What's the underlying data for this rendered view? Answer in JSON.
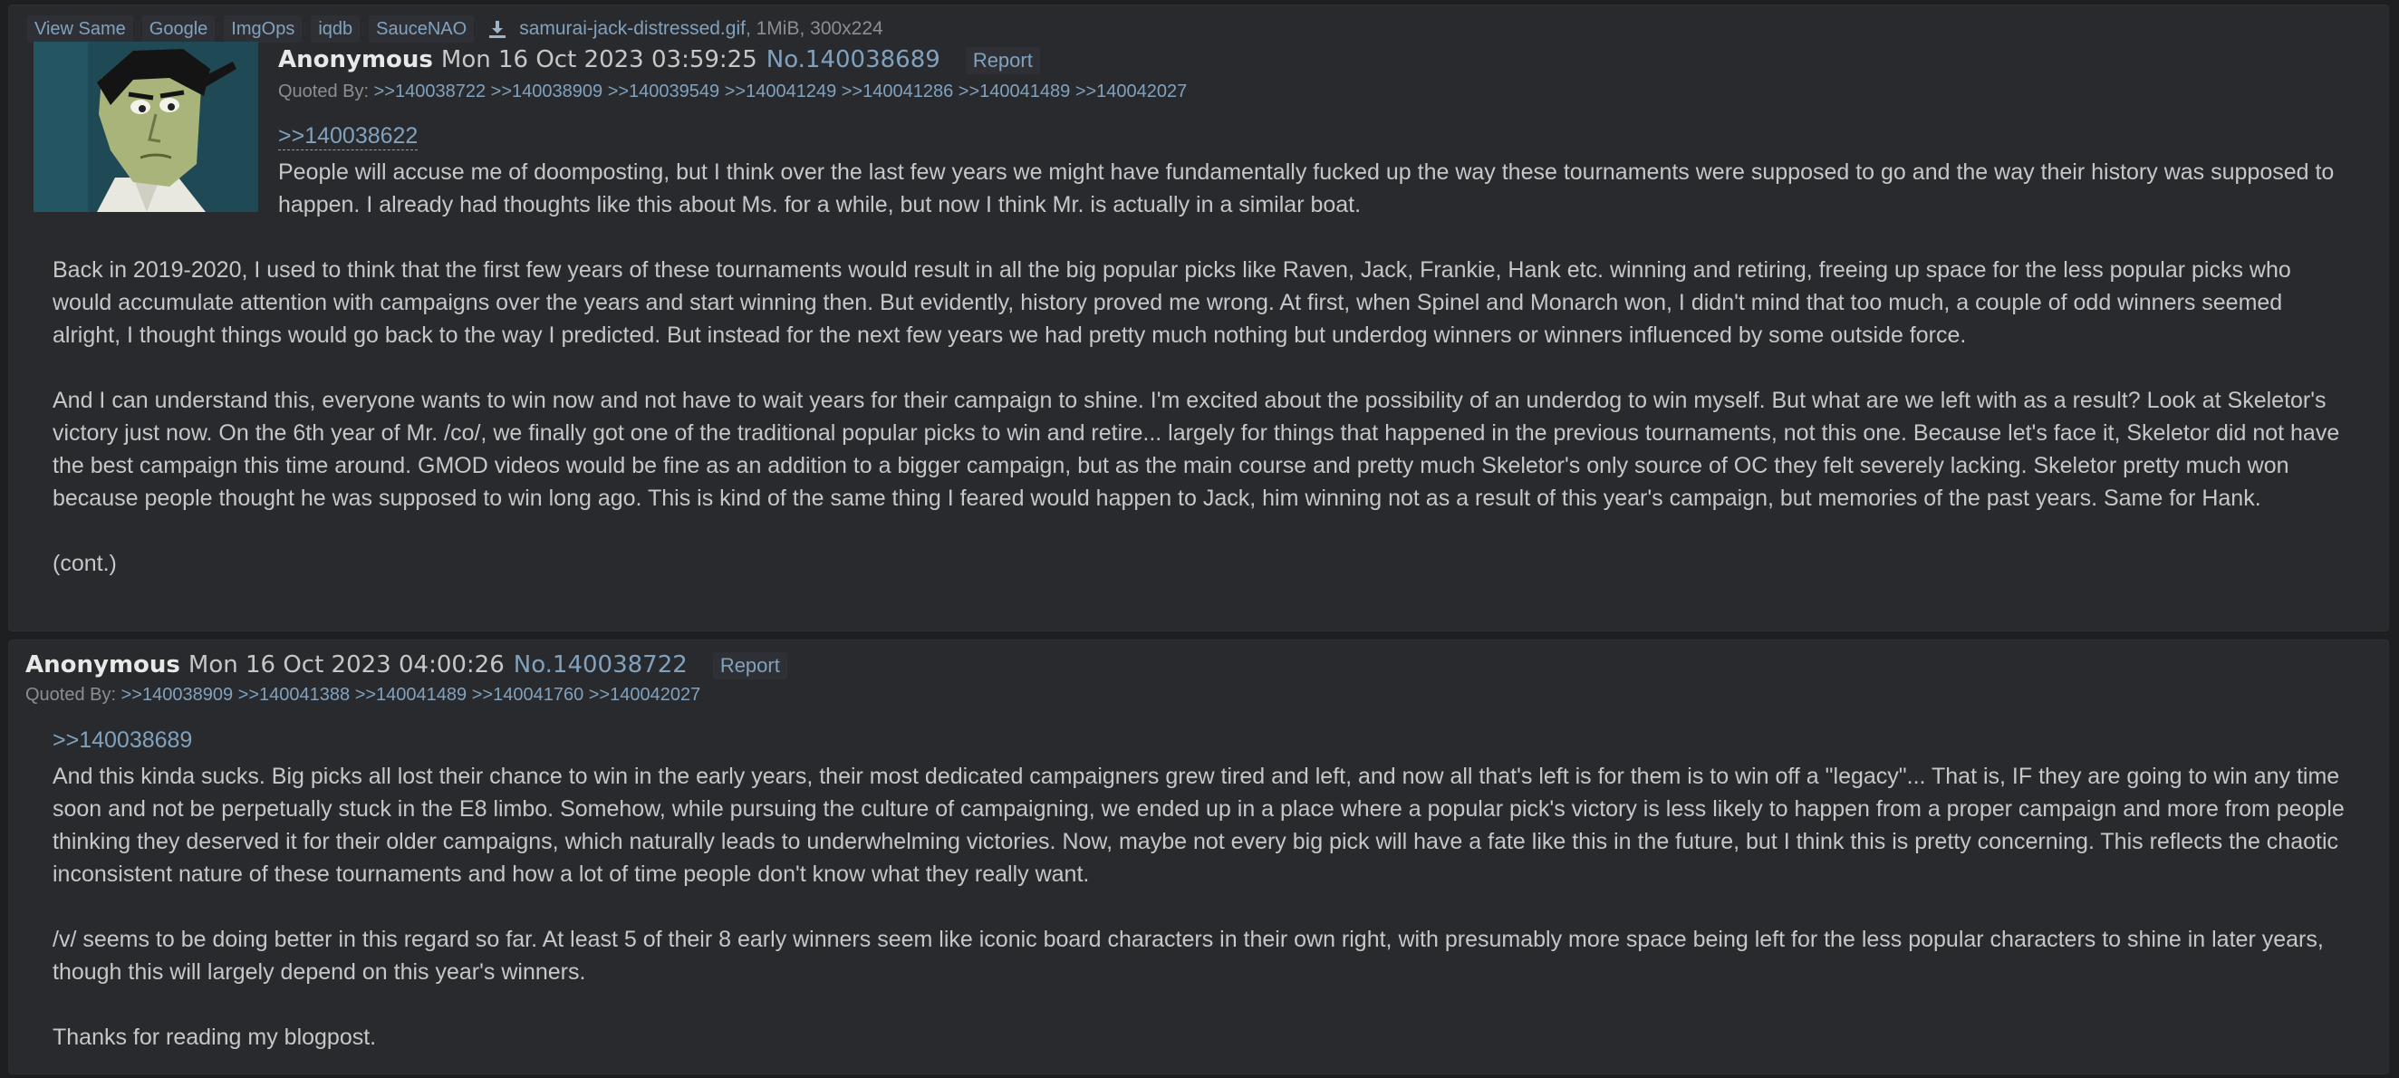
{
  "post1": {
    "file_links": [
      {
        "label": "View Same",
        "name": "view-same-link"
      },
      {
        "label": "Google",
        "name": "google-link"
      },
      {
        "label": "ImgOps",
        "name": "imgops-link"
      },
      {
        "label": "iqdb",
        "name": "iqdb-link"
      },
      {
        "label": "SauceNAO",
        "name": "saucenao-link"
      }
    ],
    "download_icon": "download-icon",
    "file_name": "samurai-jack-distressed.gif",
    "file_meta": ", 1MiB, 300x224",
    "name": "Anonymous",
    "date": "Mon 16 Oct 2023 03:59:25",
    "post_no": "No.140038689",
    "report": "Report",
    "quoted_by_label": "Quoted By:",
    "quoted_by": [
      ">>140038722",
      ">>140038909",
      ">>140039549",
      ">>140041249",
      ">>140041286",
      ">>140041489",
      ">>140042027"
    ],
    "reply_link": ">>140038689",
    "ref": ">>140038622",
    "intro": "People will accuse me of doomposting, but I think over the last few years we might have fundamentally fucked up the way these tournaments were supposed to go and the way their history was supposed to happen. I already had thoughts like this about Ms. for a while, but now I think Mr. is actually in a similar boat.",
    "paragraphs": [
      "Back in 2019-2020, I used to think that the first few years of these tournaments would result in all the big popular picks like Raven, Jack, Frankie, Hank etc. winning and retiring, freeing up space for the less popular picks who would accumulate attention with campaigns over the years and start winning then. But evidently, history proved me wrong. At first, when Spinel and Monarch won, I didn't mind that too much, a couple of odd winners seemed alright, I thought things would go back to the way I predicted. But instead for the next few years we had pretty much nothing but underdog winners or winners influenced by some outside force.",
      "And I can understand this, everyone wants to win now and not have to wait years for their campaign to shine. I'm excited about the possibility of an underdog to win myself. But what are we left with as a result? Look at Skeletor's victory just now. On the 6th year of Mr. /co/, we finally got one of the traditional popular picks to win and retire... largely for things that happened in the previous tournaments, not this one. Because let's face it, Skeletor did not have the best campaign this time around. GMOD videos would be fine as an addition to a bigger campaign, but as the main course and pretty much Skeletor's only source of OC they felt severely lacking. Skeletor pretty much won because people thought he was supposed to win long ago. This is kind of the same thing I feared would happen to Jack, him winning not as a result of this year's campaign, but memories of the past years. Same for Hank.",
      "(cont.)"
    ]
  },
  "post2": {
    "name": "Anonymous",
    "date": "Mon 16 Oct 2023 04:00:26",
    "post_no": "No.140038722",
    "report": "Report",
    "quoted_by_label": "Quoted By:",
    "quoted_by": [
      ">>140038909",
      ">>140041388",
      ">>140041489",
      ">>140041760",
      ">>140042027"
    ],
    "paragraphs": [
      "And this kinda sucks. Big picks all lost their chance to win in the early years, their most dedicated campaigners grew tired and left, and now all that's left is for them is to win off a \"legacy\"... That is, IF they are going to win any time soon and not be perpetually stuck in the E8 limbo. Somehow, while pursuing the culture of campaigning, we ended up in a place where a popular pick's victory is less likely to happen from a proper campaign and more from people thinking they deserved it for their older campaigns, which naturally leads to underwhelming victories. Now, maybe not every big pick will have a fate like this in the future, but I think this is pretty concerning. This reflects the chaotic inconsistent nature of these tournaments and how a lot of time people don't know what they really want.",
      "/v/ seems to be doing better in this regard so far. At least 5 of their 8 early winners seem like iconic board characters in their own right, with presumably more space being left for the less popular characters to shine in later years, though this will largely depend on this year's winners.",
      "Thanks for reading my blogpost."
    ]
  },
  "colors": {
    "background": "#1d1f21",
    "post_bg": "#282a2e",
    "text": "#c5c8c6",
    "link": "#81a2be",
    "muted": "#8a8f94"
  }
}
